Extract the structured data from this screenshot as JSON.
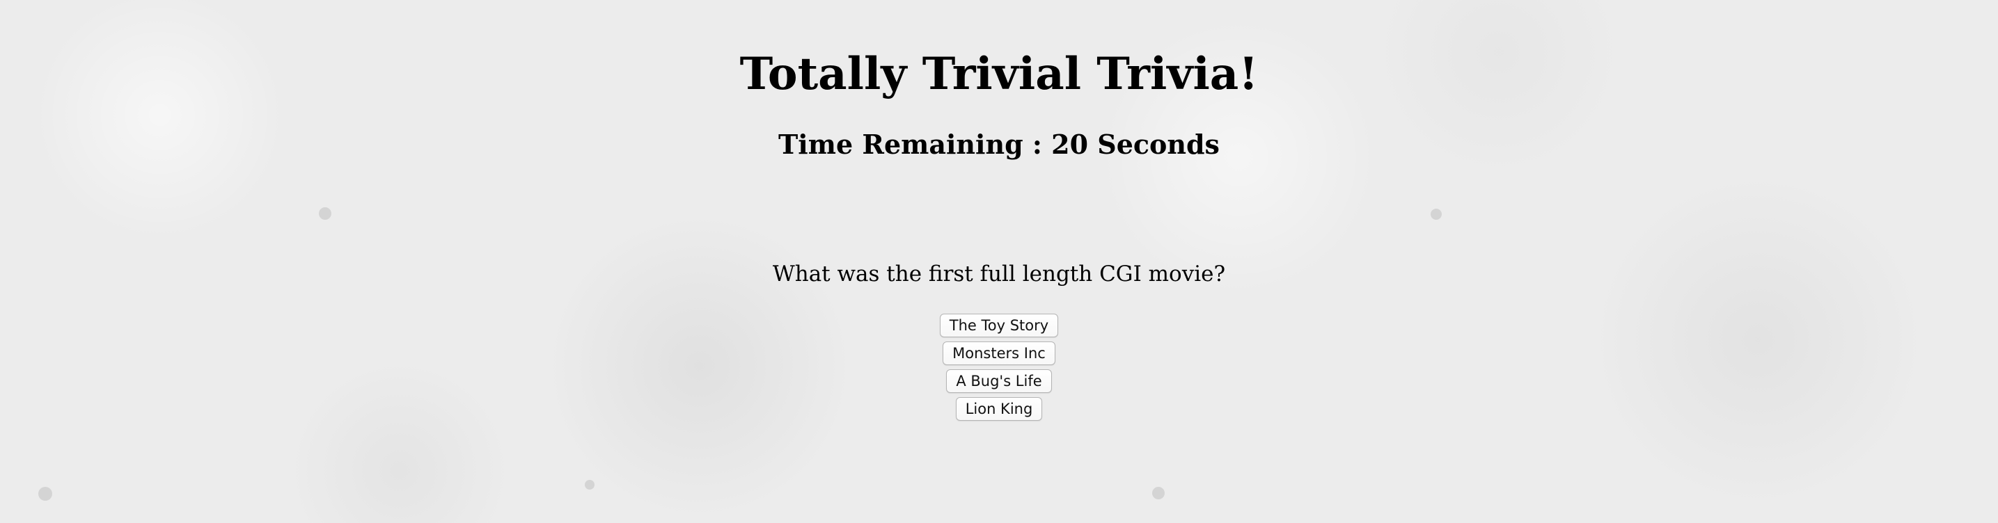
{
  "header": {
    "title": "Totally Trivial Trivia!",
    "timer_prefix": "Time Remaining : ",
    "timer_value": "20",
    "timer_unit": " Seconds"
  },
  "question": {
    "text": "What was the first full length CGI movie?",
    "answers": [
      {
        "label": "The Toy Story"
      },
      {
        "label": "Monsters Inc"
      },
      {
        "label": "A Bug's Life"
      },
      {
        "label": "Lion King"
      }
    ]
  },
  "colors": {
    "background": "#ececec",
    "text": "#000000",
    "button_border": "#b4b4b4"
  }
}
